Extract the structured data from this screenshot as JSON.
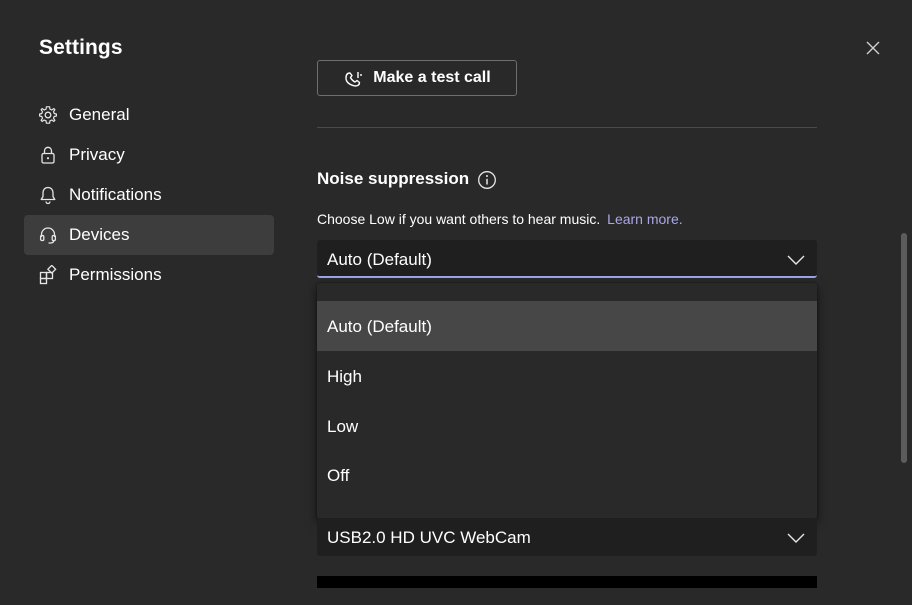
{
  "window": {
    "title": "Settings"
  },
  "sidebar": {
    "items": [
      {
        "label": "General",
        "icon": "gear-icon"
      },
      {
        "label": "Privacy",
        "icon": "lock-icon"
      },
      {
        "label": "Notifications",
        "icon": "bell-icon"
      },
      {
        "label": "Devices",
        "icon": "headset-icon",
        "active": true
      },
      {
        "label": "Permissions",
        "icon": "permissions-icon"
      }
    ]
  },
  "devices": {
    "test_call_label": "Make a test call",
    "noise_suppression": {
      "heading": "Noise suppression",
      "helper_text": "Choose Low if you want others to hear music.",
      "learn_more": "Learn more.",
      "selected": "Auto (Default)",
      "options": [
        "Auto (Default)",
        "High",
        "Low",
        "Off"
      ]
    },
    "camera": {
      "selected": "USB2.0 HD UVC WebCam"
    }
  },
  "colors": {
    "background": "#292929",
    "active_nav": "#3d3d3d",
    "accent": "#9ea2e8",
    "link": "#a9a8e6"
  }
}
